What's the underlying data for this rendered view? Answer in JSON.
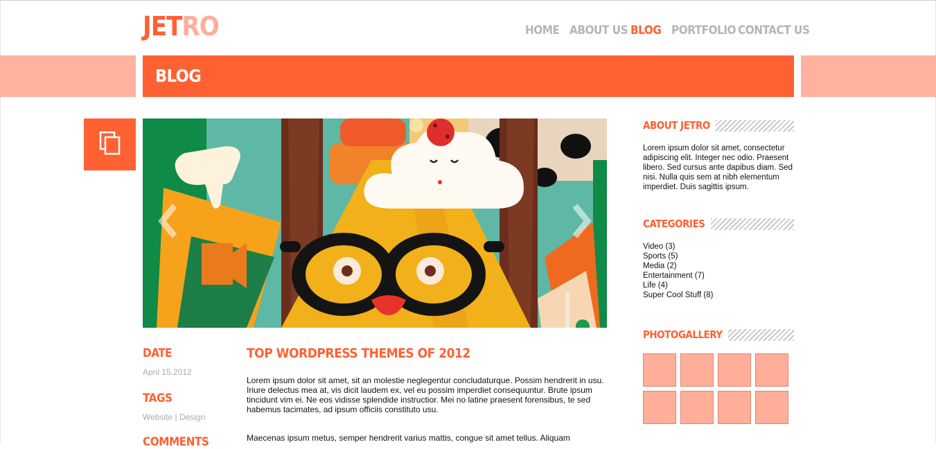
{
  "brand": {
    "logo_part1": "JET",
    "logo_part2": "RO",
    "accent": "#ff6133",
    "accent_light": "#ffae9a"
  },
  "nav": {
    "items": [
      {
        "label": "HOME"
      },
      {
        "label": "ABOUT US"
      },
      {
        "label": "BLOG",
        "active": true
      },
      {
        "label": "PORTFOLIO"
      },
      {
        "label": "CONTACT US"
      }
    ]
  },
  "page": {
    "title": "BLOG"
  },
  "post": {
    "icon": "copy-icon",
    "slider": {
      "prev_icon": "chevron-left-icon",
      "next_icon": "chevron-right-icon"
    },
    "date_label": "DATE",
    "date": "April 15.2012",
    "tags_label": "TAGS",
    "tags": [
      "Website",
      "Design"
    ],
    "tags_sep": "|",
    "comments_label": "COMMENTS",
    "title": "TOP WORDPRESS THEMES OF 2012",
    "paragraph1": "Lorem ipsum dolor sit amet, sit an molestie neglegentur concludaturque. Possim hendrerit in usu. Iriure delectus mea at, vis dicit laudem ex, vel eu possim imperdiet consequuntur. Brute ipsum tincidunt vim ei. Ne eos vidisse splendide instructior. Mei no latine praesent forensibus, te sed habemus tacimates, ad ipsum officiis constituto usu.",
    "paragraph2": "Maecenas ipsum metus, semper hendrerit varius mattis, congue sit amet tellus. Aliquam"
  },
  "sidebar": {
    "about": {
      "title": "ABOUT JETRO",
      "text": "Lorem ipsum dolor sit amet, consectetur adipiscing elit. Integer nec odio. Praesent libero. Sed cursus ante dapibus diam. Sed nisi. Nulla quis sem at nibh elementum imperdiet. Duis sagittis ipsum."
    },
    "categories": {
      "title": "CATEGORIES",
      "items": [
        {
          "label": "Video (3)"
        },
        {
          "label": "Sports (5)"
        },
        {
          "label": "Media (2)"
        },
        {
          "label": "Entertainment (7)"
        },
        {
          "label": "Life (4)"
        },
        {
          "label": "Super Cool Stuff (8)"
        }
      ]
    },
    "gallery": {
      "title": "PHOTOGALLERY",
      "count": 8
    }
  }
}
